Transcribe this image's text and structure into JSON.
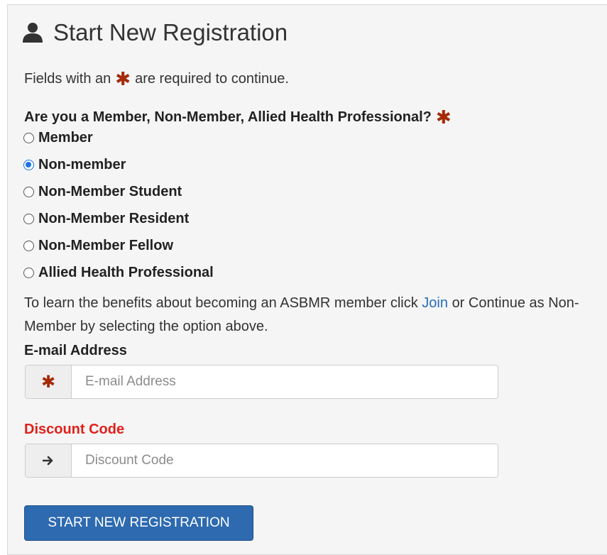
{
  "form": {
    "title": "Start New Registration",
    "required_note_prefix": "Fields with an",
    "required_note_suffix": "are required to continue.",
    "question": "Are you a Member, Non-Member, Allied Health Professional?",
    "options": [
      {
        "label": "Member",
        "selected": false
      },
      {
        "label": "Non-member",
        "selected": true
      },
      {
        "label": "Non-Member Student",
        "selected": false
      },
      {
        "label": "Non-Member Resident",
        "selected": false
      },
      {
        "label": "Non-Member Fellow",
        "selected": false
      },
      {
        "label": "Allied Health Professional",
        "selected": false
      }
    ],
    "info_prefix": "To learn the benefits about becoming an ASBMR member click",
    "info_link": "Join",
    "info_suffix": "or Continue as Non-Member by selecting the option above.",
    "email_label": "E-mail Address",
    "email_placeholder": "E-mail Address",
    "email_value": "",
    "discount_label": "Discount Code",
    "discount_placeholder": "Discount Code",
    "discount_value": "",
    "submit_label": "START NEW REGISTRATION"
  },
  "colors": {
    "required_star": "#a52a0a",
    "discount_label": "#e0201b",
    "link": "#2a6ebb",
    "button": "#2d6ab0",
    "radio_selected": "#1a73e8"
  },
  "icons": {
    "title": "user-icon",
    "required": "asterisk-icon",
    "discount": "arrow-right-icon"
  }
}
